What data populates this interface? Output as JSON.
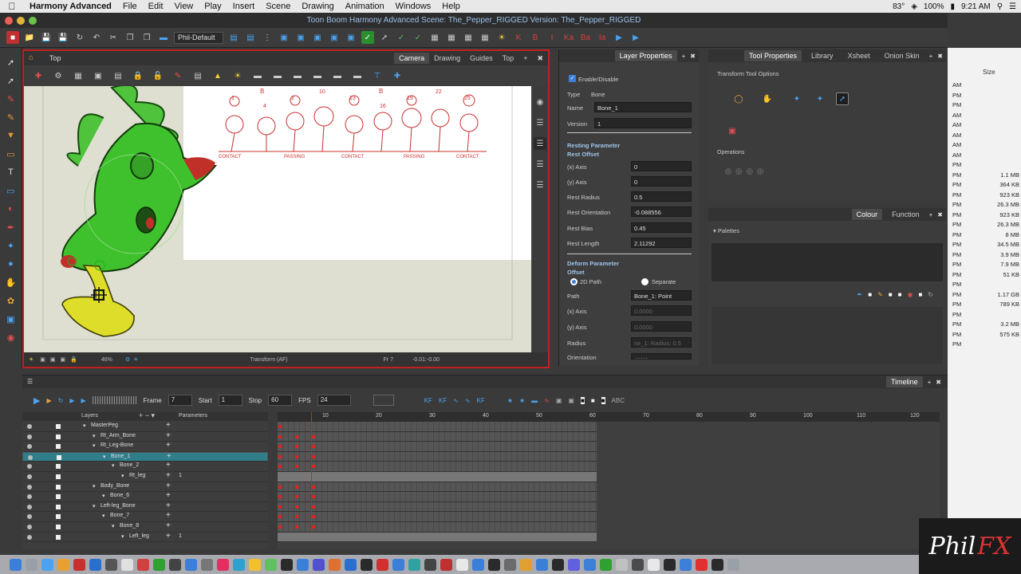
{
  "menubar": {
    "app": "Harmony Advanced",
    "items": [
      "File",
      "Edit",
      "View",
      "Play",
      "Insert",
      "Scene",
      "Drawing",
      "Animation",
      "Windows",
      "Help"
    ],
    "battery": "100%",
    "time": "9:21 AM",
    "temp": "83°"
  },
  "window": {
    "title": "Toon Boom Harmony Advanced Scene: The_Pepper_RIGGED Version: The_Pepper_RIGGED"
  },
  "toolbar": {
    "workspace_select": "Phil-Default"
  },
  "camera_panel": {
    "title": "Top",
    "tabs": [
      "Camera",
      "Drawing",
      "Guides",
      "Top"
    ],
    "active_tab": "Camera",
    "status": {
      "zoom": "46%",
      "tool": "Transform (AF)",
      "frame": "Fr 7",
      "coords": "-0.01:-0.00"
    },
    "drawing_numbers": [
      "1",
      "B",
      "2",
      "10",
      "13",
      "B",
      "19",
      "22",
      "25",
      "4",
      "16"
    ],
    "drawing_labels": [
      "CONTACT",
      "PASSING",
      "CONTACT",
      "PASSING",
      "CONTACT"
    ]
  },
  "layer_properties": {
    "title": "Layer Properties",
    "enable_label": "Enable/Disable",
    "type_label": "Type",
    "type_value": "Bone",
    "name_label": "Name",
    "name_value": "Bone_1",
    "version_label": "Version",
    "version_value": "1",
    "resting_section": "Resting Parameter",
    "rest_offset": "Rest Offset",
    "fields_rest": [
      {
        "label": "(x) Axis",
        "value": "0"
      },
      {
        "label": "(y) Axis",
        "value": "0"
      },
      {
        "label": "Rest Radius",
        "value": "0.5"
      },
      {
        "label": "Rest Orientation",
        "value": "-0.088556"
      },
      {
        "label": "Rest Bias",
        "value": "0.45"
      },
      {
        "label": "Rest Length",
        "value": "2.11292"
      }
    ],
    "deform_section": "Deform Parameter",
    "offset_label": "Offset",
    "radio_2d": "2D Path",
    "radio_separate": "Separate",
    "path_label": "Path",
    "path_value": "Bone_1: Point",
    "fields_deform": [
      {
        "label": "(x) Axis",
        "value": "0.0000"
      },
      {
        "label": "(y) Axis",
        "value": "0.0000"
      },
      {
        "label": "Radius",
        "value": "ne_1: Radius: 0.5"
      },
      {
        "label": "Orientation",
        "value": "entat..."
      }
    ]
  },
  "tool_properties": {
    "tabs": [
      "Tool Properties",
      "Library",
      "Xsheet",
      "Onion Skin"
    ],
    "active_tab": "Tool Properties",
    "options_title": "Transform Tool Options",
    "operations_title": "Operations"
  },
  "colour_panel": {
    "tabs": [
      "Colour",
      "Function"
    ],
    "active_tab": "Colour",
    "palettes_label": "Palettes"
  },
  "timeline": {
    "title": "Timeline",
    "frame_label": "Frame",
    "frame_value": "7",
    "start_label": "Start",
    "start_value": "1",
    "stop_label": "Stop",
    "stop_value": "60",
    "fps_label": "FPS",
    "fps_value": "24",
    "layers_header": "Layers",
    "parameters_header": "Parameters",
    "ruler_marks": [
      "10",
      "20",
      "30",
      "40",
      "50",
      "60",
      "70",
      "80",
      "90",
      "100",
      "110",
      "120"
    ],
    "layers": [
      {
        "name": "MasterPeg",
        "indent": 0,
        "selected": false,
        "param": ""
      },
      {
        "name": "Rt_Arm_Bone",
        "indent": 1,
        "selected": false,
        "param": ""
      },
      {
        "name": "Rt_Leg-Bone",
        "indent": 1,
        "selected": false,
        "param": ""
      },
      {
        "name": "Bone_1",
        "indent": 2,
        "selected": true,
        "param": ""
      },
      {
        "name": "Bone_2",
        "indent": 3,
        "selected": false,
        "param": ""
      },
      {
        "name": "Rt_leg",
        "indent": 4,
        "selected": false,
        "param": "1"
      },
      {
        "name": "Body_Bone",
        "indent": 1,
        "selected": false,
        "param": ""
      },
      {
        "name": "Bone_6",
        "indent": 2,
        "selected": false,
        "param": ""
      },
      {
        "name": "Left-leg_Bone",
        "indent": 1,
        "selected": false,
        "param": ""
      },
      {
        "name": "Bone_7",
        "indent": 2,
        "selected": false,
        "param": ""
      },
      {
        "name": "Bone_8",
        "indent": 3,
        "selected": false,
        "param": ""
      },
      {
        "name": "Left_leg",
        "indent": 4,
        "selected": false,
        "param": "1"
      }
    ]
  },
  "finder": {
    "size_header": "Size",
    "rows": [
      "AM",
      "PM",
      "PM",
      "AM",
      "AM",
      "AM",
      "AM",
      "AM",
      "PM",
      "PM",
      "PM",
      "PM",
      "PM",
      "PM",
      "PM",
      "PM",
      "PM",
      "PM",
      "PM",
      "PM",
      "PM",
      "PM",
      "PM",
      "PM",
      "PM",
      "PM",
      "PM"
    ],
    "sizes": [
      "",
      "",
      "",
      "",
      "",
      "",
      "",
      "",
      "",
      "1.1 MB",
      "364 KB",
      "923 KB",
      "26.3 MB",
      "923 KB",
      "26.3 MB",
      "8 MB",
      "34.5 MB",
      "3.9 MB",
      "7.9 MB",
      "51 KB",
      "",
      "1.17 GB",
      "789 KB",
      "",
      "3.2 MB",
      "575 KB",
      ""
    ]
  },
  "watermark": {
    "left": "Phil",
    "right": "FX"
  }
}
